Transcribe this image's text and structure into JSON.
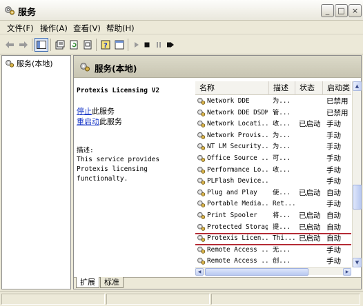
{
  "window": {
    "title": "服务",
    "controls": [
      "_",
      "□",
      "×"
    ]
  },
  "menu": [
    "文件(F)",
    "操作(A)",
    "查看(V)",
    "帮助(H)"
  ],
  "toolbar_icons": [
    "back-icon",
    "forward-icon",
    "console-tree-icon",
    "properties-icon",
    "refresh-icon",
    "export-icon",
    "help-icon",
    "console-icon",
    "play-icon",
    "stop-icon",
    "pause-icon",
    "restart-icon"
  ],
  "tree": {
    "root_label": "服务(本地)"
  },
  "content_header": "服务(本地)",
  "extended": {
    "service_title": "Protexis Licensing V2",
    "stop_link": "停止",
    "stop_suffix": "此服务",
    "restart_link": "重启动",
    "restart_suffix": "此服务",
    "desc_label": "描述:",
    "desc_text": "This service provides Protexis licensing functionalty."
  },
  "columns": [
    "名称",
    "描述",
    "状态",
    "启动类"
  ],
  "rows": [
    {
      "name": "Network DDE",
      "desc": "为...",
      "status": "",
      "start": "已禁用"
    },
    {
      "name": "Network DDE DSDM",
      "desc": "管...",
      "status": "",
      "start": "已禁用"
    },
    {
      "name": "Network Locati...",
      "desc": "收...",
      "status": "已启动",
      "start": "手动"
    },
    {
      "name": "Network Provis...",
      "desc": "为...",
      "status": "",
      "start": "手动"
    },
    {
      "name": "NT LM Security...",
      "desc": "为...",
      "status": "",
      "start": "手动"
    },
    {
      "name": "Office Source ...",
      "desc": "可...",
      "status": "",
      "start": "手动"
    },
    {
      "name": "Performance Lo...",
      "desc": "收...",
      "status": "",
      "start": "手动"
    },
    {
      "name": "PLFlash Device...",
      "desc": "",
      "status": "",
      "start": "手动"
    },
    {
      "name": "Plug and Play",
      "desc": "使...",
      "status": "已启动",
      "start": "自动"
    },
    {
      "name": "Portable Media...",
      "desc": "Ret...",
      "status": "",
      "start": "手动"
    },
    {
      "name": "Print Spooler",
      "desc": "将...",
      "status": "已启动",
      "start": "自动"
    },
    {
      "name": "Protected Storage",
      "desc": "提...",
      "status": "已启动",
      "start": "自动"
    },
    {
      "name": "Protexis Licen...",
      "desc": "Thi...",
      "status": "已启动",
      "start": "自动"
    },
    {
      "name": "Remote Access ...",
      "desc": "无...",
      "status": "",
      "start": "手动"
    },
    {
      "name": "Remote Access ...",
      "desc": "创...",
      "status": "",
      "start": "手动"
    }
  ],
  "selected_row_index": 12,
  "tabs": [
    "扩展",
    "标准"
  ],
  "active_tab_index": 0,
  "colors": {
    "link": "#1a39c8",
    "highlight": "#b42b35"
  }
}
